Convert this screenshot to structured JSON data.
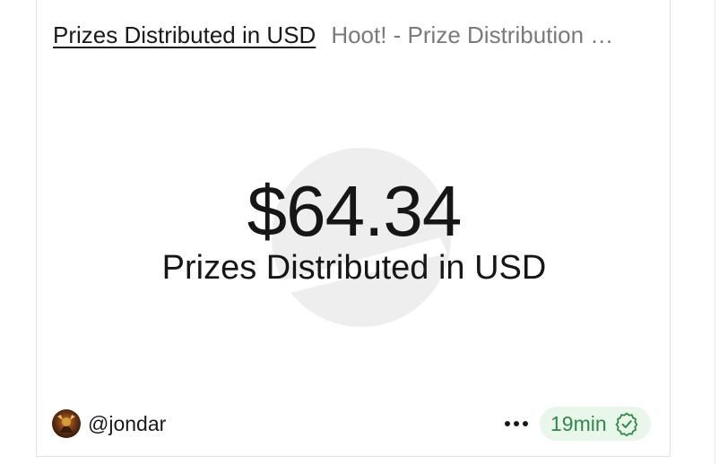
{
  "card": {
    "title": "Prizes Distributed in USD",
    "query_name": "Hoot! - Prize Distribution …"
  },
  "counter": {
    "value": "$64.34",
    "label": "Prizes Distributed in USD"
  },
  "footer": {
    "username": "@jondar",
    "time": "19min",
    "more_icon": "more-horizontal-icon",
    "verified_icon": "verified-check-icon"
  },
  "colors": {
    "badge_bg": "#e9f6ea",
    "badge_text": "#2f8a4a",
    "query_text": "#7a7a7a",
    "watermark": "#eeeeee"
  }
}
